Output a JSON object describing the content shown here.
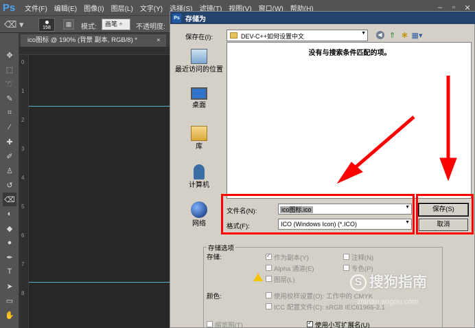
{
  "app": {
    "logo": "Ps",
    "menu": [
      "文件(F)",
      "编辑(E)",
      "图像(I)",
      "图层(L)",
      "文字(Y)",
      "选择(S)",
      "滤镜(T)",
      "视图(V)",
      "窗口(W)",
      "帮助(H)"
    ],
    "window_controls": [
      "minimize-icon",
      "maximize-icon",
      "close-icon"
    ]
  },
  "options_bar": {
    "brush_size": "158",
    "mode_label": "模式:",
    "mode_value": "画笔",
    "opacity_label": "不透明度:"
  },
  "document": {
    "tab_title": "ico图标 @ 190% (背景 副本, RGB/8) *",
    "close_glyph": "×",
    "ruler_marks": [
      "0",
      "1",
      "2",
      "3",
      "4",
      "5",
      "6",
      "7",
      "8"
    ]
  },
  "tools": [
    "move-tool-icon",
    "marquee-tool-icon",
    "lasso-tool-icon",
    "quick-select-tool-icon",
    "crop-tool-icon",
    "eyedropper-tool-icon",
    "healing-brush-tool-icon",
    "brush-tool-icon",
    "clone-stamp-tool-icon",
    "history-brush-tool-icon",
    "eraser-tool-icon",
    "paint-bucket-tool-icon",
    "blur-tool-icon",
    "dodge-tool-icon",
    "pen-tool-icon",
    "type-tool-icon",
    "path-select-tool-icon",
    "shape-tool-icon",
    "hand-tool-icon"
  ],
  "dialog": {
    "title": "存储为",
    "title_icon": "Ps",
    "save_in_label": "保存在(I):",
    "save_in_value": "DEV-C++如何设置中文",
    "empty_message": "没有与搜索条件匹配的项。",
    "places": [
      {
        "label": "最近访问的位置",
        "icon": "recent-places-icon"
      },
      {
        "label": "桌面",
        "icon": "desktop-icon"
      },
      {
        "label": "库",
        "icon": "libraries-icon"
      },
      {
        "label": "计算机",
        "icon": "computer-icon"
      },
      {
        "label": "网络",
        "icon": "network-icon"
      }
    ],
    "filename_label": "文件名(N):",
    "filename_value": "ico图标.ico",
    "format_label": "格式(F):",
    "format_value": "ICO (Windows Icon) (*.ICO)",
    "save_button": "保存(S)",
    "cancel_button": "取消",
    "options": {
      "legend": "存储选项",
      "storage_label": "存储:",
      "as_copy": "作为副本(Y)",
      "alpha_channels": "Alpha 通道(E)",
      "layers": "图层(L)",
      "notes": "注释(N)",
      "spot_colors": "专色(P)",
      "color_label": "颜色:",
      "use_proof": "使用校样设置(O): 工作中的 CMYK",
      "icc_profile": "ICC 配置文件(C): sRGB IEC61966-2.1",
      "thumbnail": "缩览图(T)",
      "lowercase_ext": "使用小写扩展名(U)"
    }
  },
  "watermark": {
    "logo": "S",
    "text": "搜狗指南",
    "url": "zhinan.sogou.com"
  },
  "colors": {
    "annotation_red": "#ff0000",
    "guide_cyan": "#55b5c9",
    "dialog_bg": "#d4d0c8",
    "title_bar": "#26436e"
  }
}
